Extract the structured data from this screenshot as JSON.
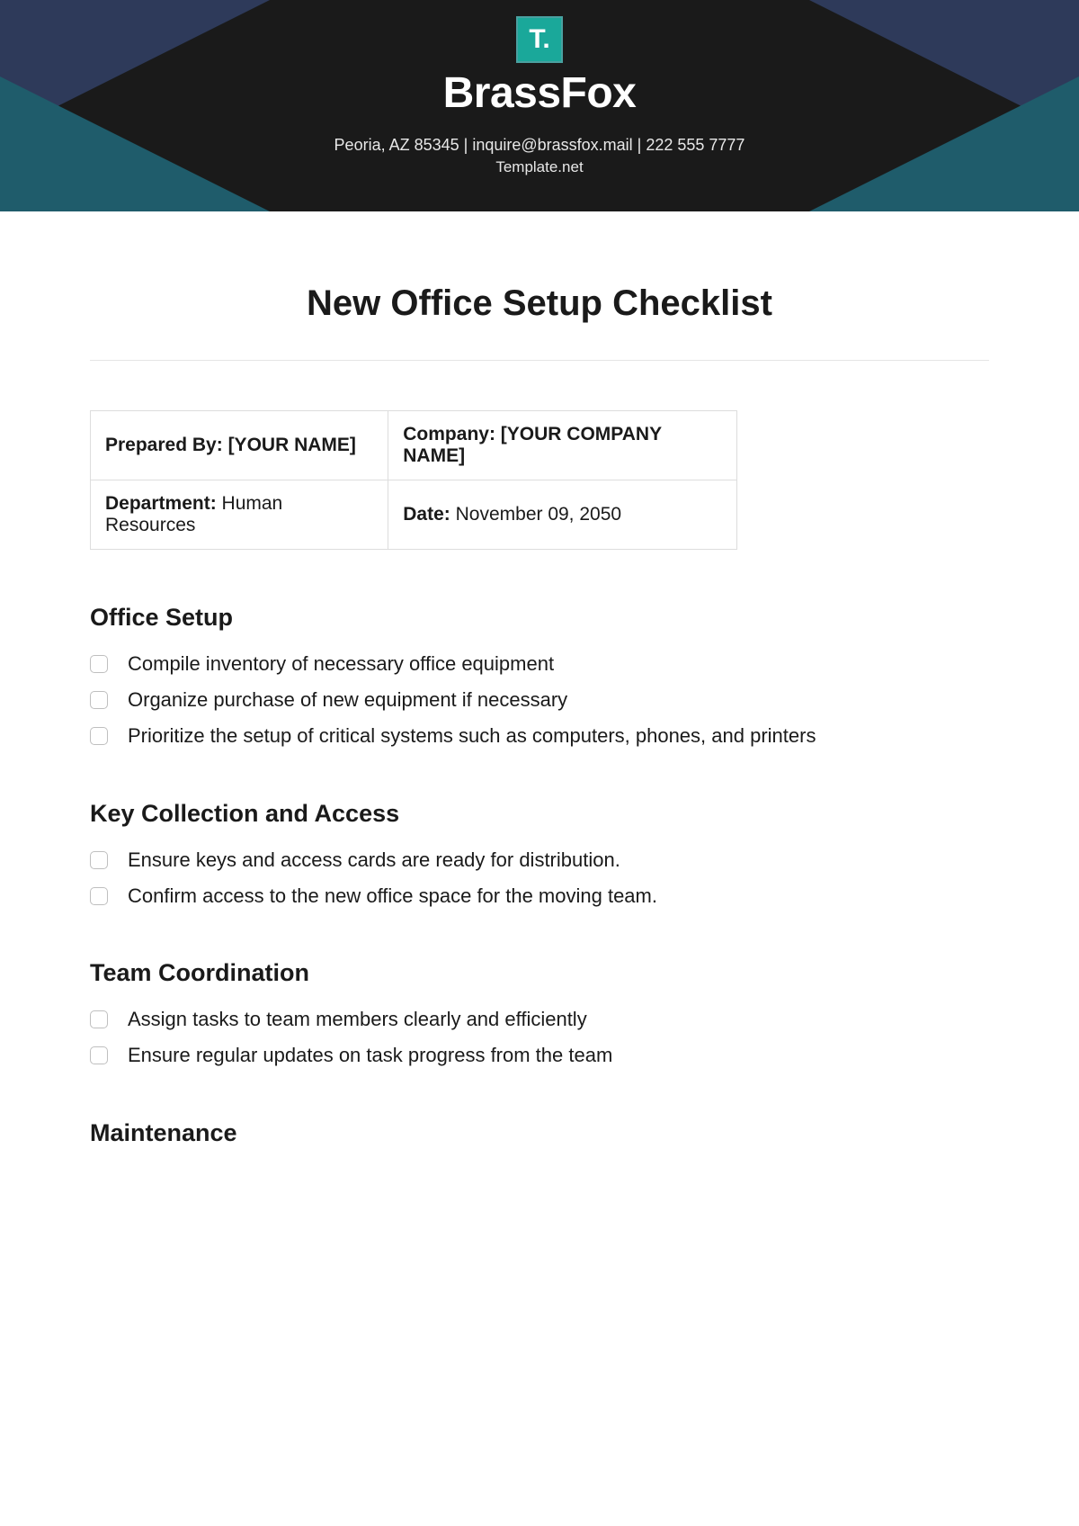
{
  "header": {
    "logo_text": "T.",
    "brand": "BrassFox",
    "contact_line": "Peoria, AZ 85345 | inquire@brassfox.mail | 222 555 7777",
    "subline": "Template.net"
  },
  "title": "New Office Setup Checklist",
  "meta": {
    "prepared_by_label": "Prepared By:",
    "prepared_by_value": "[YOUR NAME]",
    "company_label": "Company:",
    "company_value": "[YOUR COMPANY NAME]",
    "department_label": "Department:",
    "department_value": "Human Resources",
    "date_label": "Date:",
    "date_value": "November 09, 2050"
  },
  "sections": [
    {
      "heading": "Office Setup",
      "items": [
        "Compile inventory of necessary office equipment",
        "Organize purchase of new equipment if necessary",
        "Prioritize the setup of critical systems such as computers, phones, and printers"
      ]
    },
    {
      "heading": "Key Collection and Access",
      "items": [
        "Ensure keys and access cards are ready for distribution.",
        "Confirm access to the new office space for the moving team."
      ]
    },
    {
      "heading": "Team Coordination",
      "items": [
        "Assign tasks to team members clearly and efficiently",
        "Ensure regular updates on task progress from the team"
      ]
    },
    {
      "heading": "Maintenance",
      "items": []
    }
  ]
}
